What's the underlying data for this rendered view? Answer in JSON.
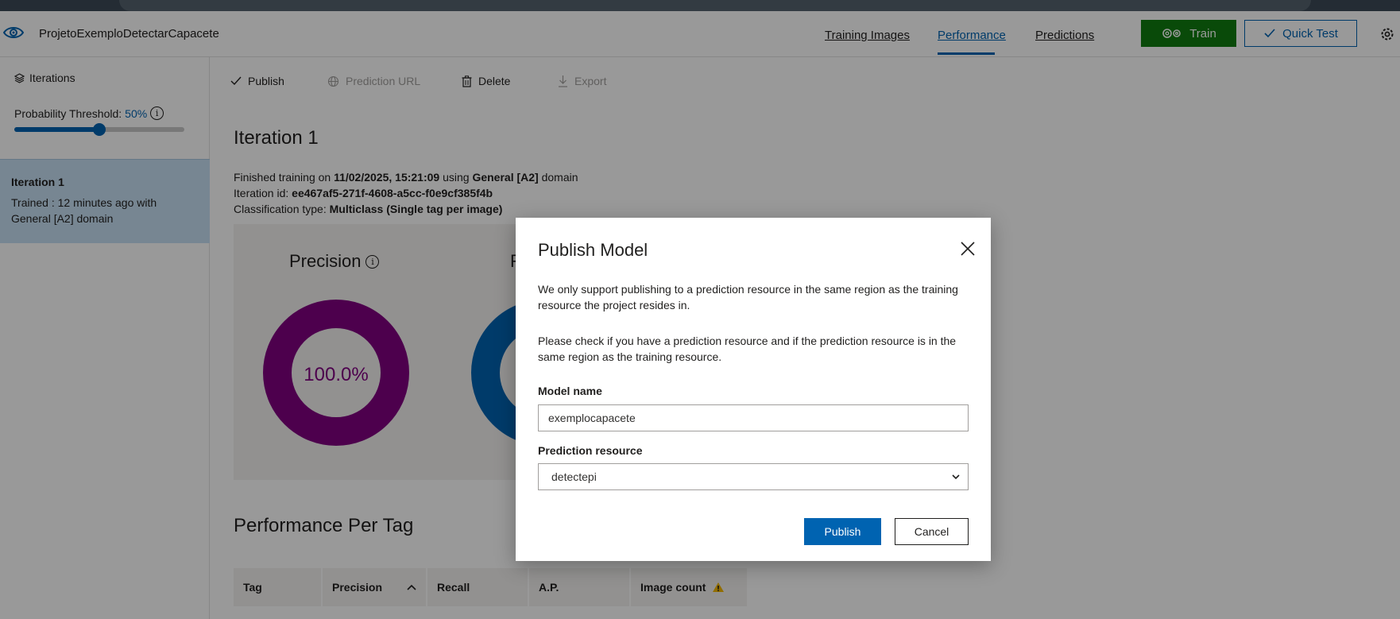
{
  "header": {
    "project_name": "ProjetoExemploDetectarCapacete",
    "tabs": [
      {
        "label": "Training Images"
      },
      {
        "label": "Performance"
      },
      {
        "label": "Predictions"
      }
    ],
    "train_label": "Train",
    "quick_test_label": "Quick Test"
  },
  "sidebar": {
    "iterations_label": "Iterations",
    "threshold_label": "Probability Threshold:",
    "threshold_value": "50%",
    "threshold_fraction": 0.5,
    "iteration_card": {
      "title": "Iteration 1",
      "desc": "Trained : 12 minutes ago with General [A2] domain"
    }
  },
  "toolbar": {
    "publish": "Publish",
    "prediction_url": "Prediction URL",
    "delete": "Delete",
    "export": "Export"
  },
  "iteration": {
    "title": "Iteration 1",
    "finished_prefix": "Finished training on ",
    "finished_date": "11/02/2025, 15:21:09",
    "finished_using": " using ",
    "domain": "General [A2]",
    "domain_suffix": " domain",
    "id_label": "Iteration id: ",
    "id_value": "ee467af5-271f-4608-a5cc-f0e9cf385f4b",
    "class_label": "Classification type: ",
    "class_value": "Multiclass (Single tag per image)"
  },
  "metrics": {
    "precision_label": "Precision",
    "precision_value": "100.0%",
    "recall_label_partial": "R"
  },
  "perf_per_tag": {
    "title": "Performance Per Tag",
    "columns": [
      "Tag",
      "Precision",
      "Recall",
      "A.P.",
      "Image count"
    ]
  },
  "modal": {
    "title": "Publish Model",
    "p1": "We only support publishing to a prediction resource in the same region as the training resource the project resides in.",
    "p2": "Please check if you have a prediction resource and if the prediction resource is in the same region as the training resource.",
    "model_name_label": "Model name",
    "model_name_value": "exemplocapacete",
    "prediction_resource_label": "Prediction resource",
    "prediction_resource_value": "detectepi",
    "publish_button": "Publish",
    "cancel_button": "Cancel"
  },
  "colors": {
    "accent": "#0063b1",
    "train_green": "#107c10",
    "precision_donut": "#800080",
    "recall_donut": "#0063b1",
    "selected_iteration": "#c7e0f4"
  }
}
